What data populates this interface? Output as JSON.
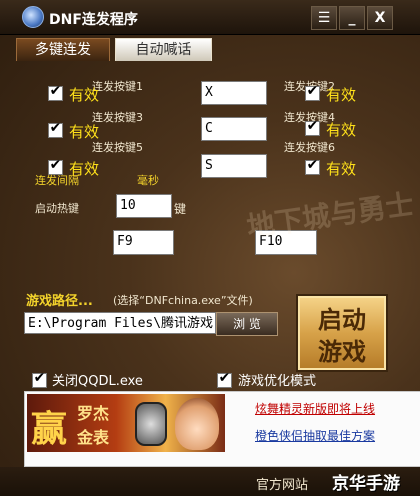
{
  "window": {
    "title": "DNF连发程序"
  },
  "titlebar_buttons": {
    "menu": "☰",
    "minimize": "_",
    "close": "X"
  },
  "tabs": [
    {
      "label": "多键连发"
    },
    {
      "label": "自动喊话"
    }
  ],
  "hotkeys": [
    {
      "label": "连发按键1",
      "enabled_text": "有效",
      "value": "X"
    },
    {
      "label": "连发按键2",
      "enabled_text": "有效"
    },
    {
      "label": "连发按键3",
      "enabled_text": "有效",
      "value": "C"
    },
    {
      "label": "连发按键4",
      "enabled_text": "有效"
    },
    {
      "label": "连发按键5",
      "enabled_text": "有效",
      "value": "S"
    },
    {
      "label": "连发按键6",
      "enabled_text": "有效"
    }
  ],
  "interval": {
    "label": "连发间隔",
    "unit": "毫秒"
  },
  "start_hotkey": {
    "label": "启动热键",
    "value": "10",
    "suffix": "键"
  },
  "key_fields": {
    "f9": "F9",
    "f10": "F10"
  },
  "watermark": "地下城与勇士",
  "game_path": {
    "label": "游戏路径...",
    "hint": "(选择“DNFchina.exe”文件)",
    "value": "E:\\Program Files\\腾讯游戏",
    "browse": "浏 览"
  },
  "start": {
    "line1": "启动",
    "line2": "游戏"
  },
  "options": [
    {
      "label": "关闭QQDL.exe"
    },
    {
      "label": "游戏优化模式"
    }
  ],
  "ad": {
    "big": "赢",
    "brand1": "罗杰",
    "brand2": "金表",
    "link1": "炫舞精灵新版即将上线",
    "link2": "橙色侠侣抽取最佳方案"
  },
  "footer": {
    "site": "官方网站",
    "logo": "京华手游"
  },
  "colors": {
    "accent_yellow": "#f3d32b",
    "link_red": "#c00000"
  }
}
